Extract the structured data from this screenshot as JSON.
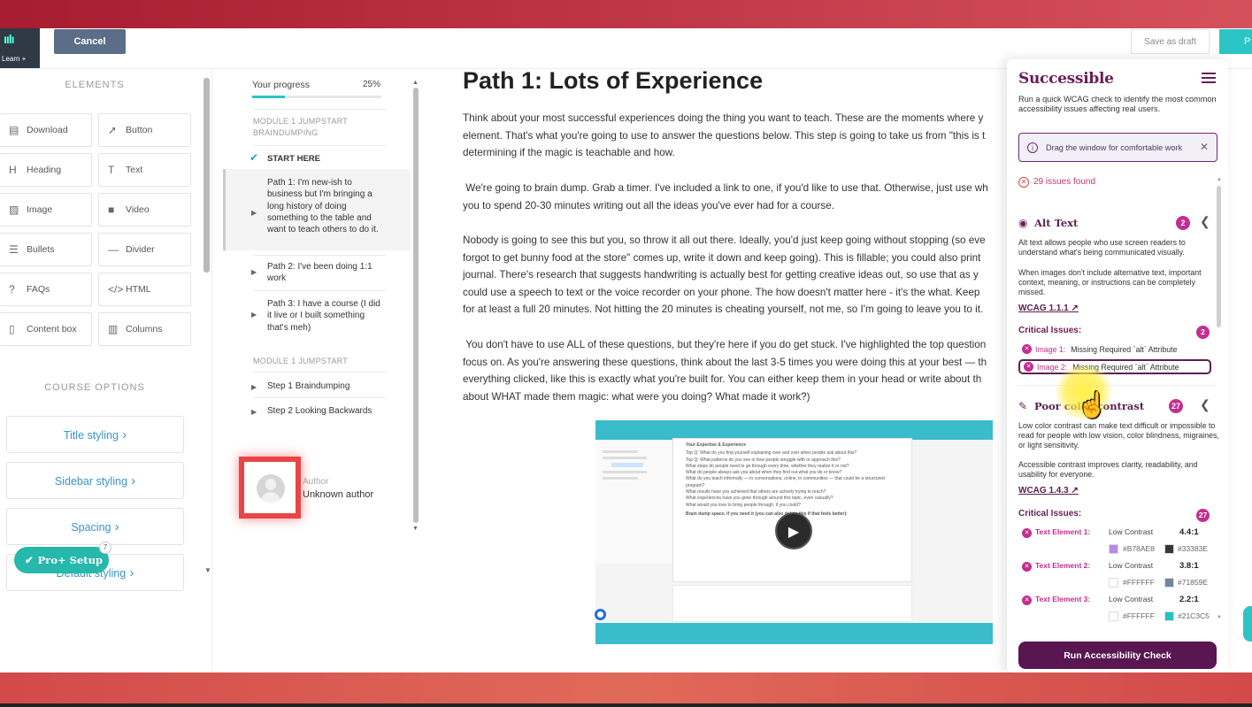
{
  "topbar": {
    "logo_text": "Learn +",
    "cancel_label": "Cancel",
    "save_draft_label": "Save as draft",
    "publish_label": "P"
  },
  "elements_panel": {
    "title": "ELEMENTS",
    "items": [
      {
        "label": "Download",
        "icon": "download-icon",
        "glyph": "▤"
      },
      {
        "label": "Button",
        "icon": "cursor-icon",
        "glyph": "➚"
      },
      {
        "label": "Heading",
        "icon": "heading-icon",
        "glyph": "H"
      },
      {
        "label": "Text",
        "icon": "text-icon",
        "glyph": "T"
      },
      {
        "label": "Image",
        "icon": "image-icon",
        "glyph": "▨"
      },
      {
        "label": "Video",
        "icon": "video-icon",
        "glyph": "■"
      },
      {
        "label": "Bullets",
        "icon": "bullets-icon",
        "glyph": "☰"
      },
      {
        "label": "Divider",
        "icon": "divider-icon",
        "glyph": "—"
      },
      {
        "label": "FAQs",
        "icon": "faq-icon",
        "glyph": "?"
      },
      {
        "label": "HTML",
        "icon": "code-icon",
        "glyph": "</>"
      },
      {
        "label": "Content box",
        "icon": "content-box-icon",
        "glyph": "▯"
      },
      {
        "label": "Columns",
        "icon": "columns-icon",
        "glyph": "▥"
      }
    ],
    "course_options_title": "COURSE OPTIONS",
    "course_options": [
      "Title styling",
      "Sidebar styling",
      "Spacing",
      "Default styling"
    ],
    "proplus_label": "Pro+ Setup",
    "proplus_badge": "7"
  },
  "course_nav": {
    "progress_label": "Your progress",
    "progress_pct": "25%",
    "progress_value": 0.25,
    "module1": "MODULE 1 JUMPSTART BRAINDUMPING",
    "start_here": "START HERE",
    "lessons1": [
      "Path 1: I'm new-ish to business but I'm bringing a long history of doing something to the table and want to teach others to do it.",
      "Path 2: I've been doing 1:1 work",
      "Path 3: I have a course (I did it live or I built something that's meh)"
    ],
    "module2": "MODULE 1 JUMPSTART",
    "lessons2": [
      "Step 1 Braindumping",
      "Step 2 Looking Backwards"
    ],
    "author_label": "Author",
    "author_name": "Unknown author"
  },
  "content": {
    "heading": "Path 1: Lots of Experience",
    "paragraphs": [
      "Think about your most successful experiences doing the thing you want to teach. These are the moments where y\nelement. That's what you're going to use to answer the questions below. This step is going to take us from \"this is t\ndetermining if the magic is teachable and how.",
      " We're going to brain dump. Grab a timer. I've included a link to one, if you'd like to use that. Otherwise, just use wh\nyou to spend 20-30 minutes writing out all the ideas you've ever had for a course.",
      "Nobody is going to see this but you, so throw it all out there. Ideally, you'd just keep going without stopping (so eve\nforgot to get bunny food at the store\" comes up, write it down and keep going). This is fillable; you could also print\njournal. There's research that suggests handwriting is actually best for getting creative ideas out, so use that as y\ncould use a speech to text or the voice recorder on your phone. The how doesn't matter here - it's the what. Keep\nfor at least a full 20 minutes. Not hitting the 20 minutes is cheating yourself, not me, so I'm going to leave you to it.",
      " You don't have to use ALL of these questions, but they're here if you do get stuck. I've highlighted the top question\nfocus on. As you're answering these questions, think about the last 3-5 times you were doing this at your best — th\neverything clicked, like this is exactly what you're built for. You can either keep them in your head or write about th\nabout WHAT made them magic: what were you doing? What made it work?)"
    ],
    "video_doc_title": "Your Expertise & Experience",
    "video_doc_lines": [
      "Top Q: What do you find yourself explaining over and over when people ask about this?",
      "Top Q: What patterns do you see in how people struggle with or approach this?",
      "What steps do people need to go through every time, whether they realize it or not?",
      "What do people always ask you about when they find out what you do or know?",
      "What do you teach informally — in conversations, online, in communities — that could be a structured program?",
      "What results have you achieved that others are actively trying to reach?",
      "What experiences have you gone through around this topic, even casually?",
      "What would you love to bring people through, if you could?",
      "Brain dump space, if you need it (you can also delete this if that feels better):"
    ]
  },
  "extension": {
    "brand": "Successible",
    "intro": "Run a quick WCAG check to identify the most common accessibility issues affecting real users.",
    "drag_hint": "Drag the window for comfortable work",
    "issues_found": "29 issues found",
    "alt_text": {
      "title": "Alt Text",
      "count": "2",
      "desc1": "Alt text allows people who use screen readers to understand what's being communicated visually.",
      "desc2": "When images don't include alternative text, important context, meaning, or instructions can be completely missed.",
      "wcag": "WCAG 1.1.1",
      "critical_label": "Critical Issues:",
      "critical_count": "2",
      "issues": [
        {
          "name": "Image 1:",
          "msg": "Missing Required `alt` Attribute"
        },
        {
          "name": "Image 2:",
          "msg": "Missing Required `alt` Attribute"
        }
      ]
    },
    "contrast": {
      "title": "Poor color contrast",
      "count": "27",
      "desc1": "Low color contrast can make text difficult or impossible to read for people with low vision, color blindness, migraines, or light sensitivity.",
      "desc2": "Accessible contrast improves clarity, readability, and usability for everyone.",
      "wcag": "WCAG 1.4.3",
      "critical_label": "Critical Issues:",
      "critical_count": "27",
      "issues": [
        {
          "name": "Text Element 1:",
          "label": "Low Contrast",
          "ratio": "4.4:1",
          "fg": "#B78AE8",
          "bg": "#33383E"
        },
        {
          "name": "Text Element 2:",
          "label": "Low Contrast",
          "ratio": "3.8:1",
          "fg": "#FFFFFF",
          "bg": "#71859E"
        },
        {
          "name": "Text Element 3:",
          "label": "Low Contrast",
          "ratio": "2.2:1",
          "fg": "#FFFFFF",
          "bg": "#21C3C5"
        }
      ]
    },
    "run_label": "Run Accessibility Check"
  },
  "colors": {
    "brand_purple": "#5A1651",
    "accent_teal": "#2CC4C4",
    "badge_pink": "#C42D8F",
    "link_blue": "#3A94C5"
  }
}
